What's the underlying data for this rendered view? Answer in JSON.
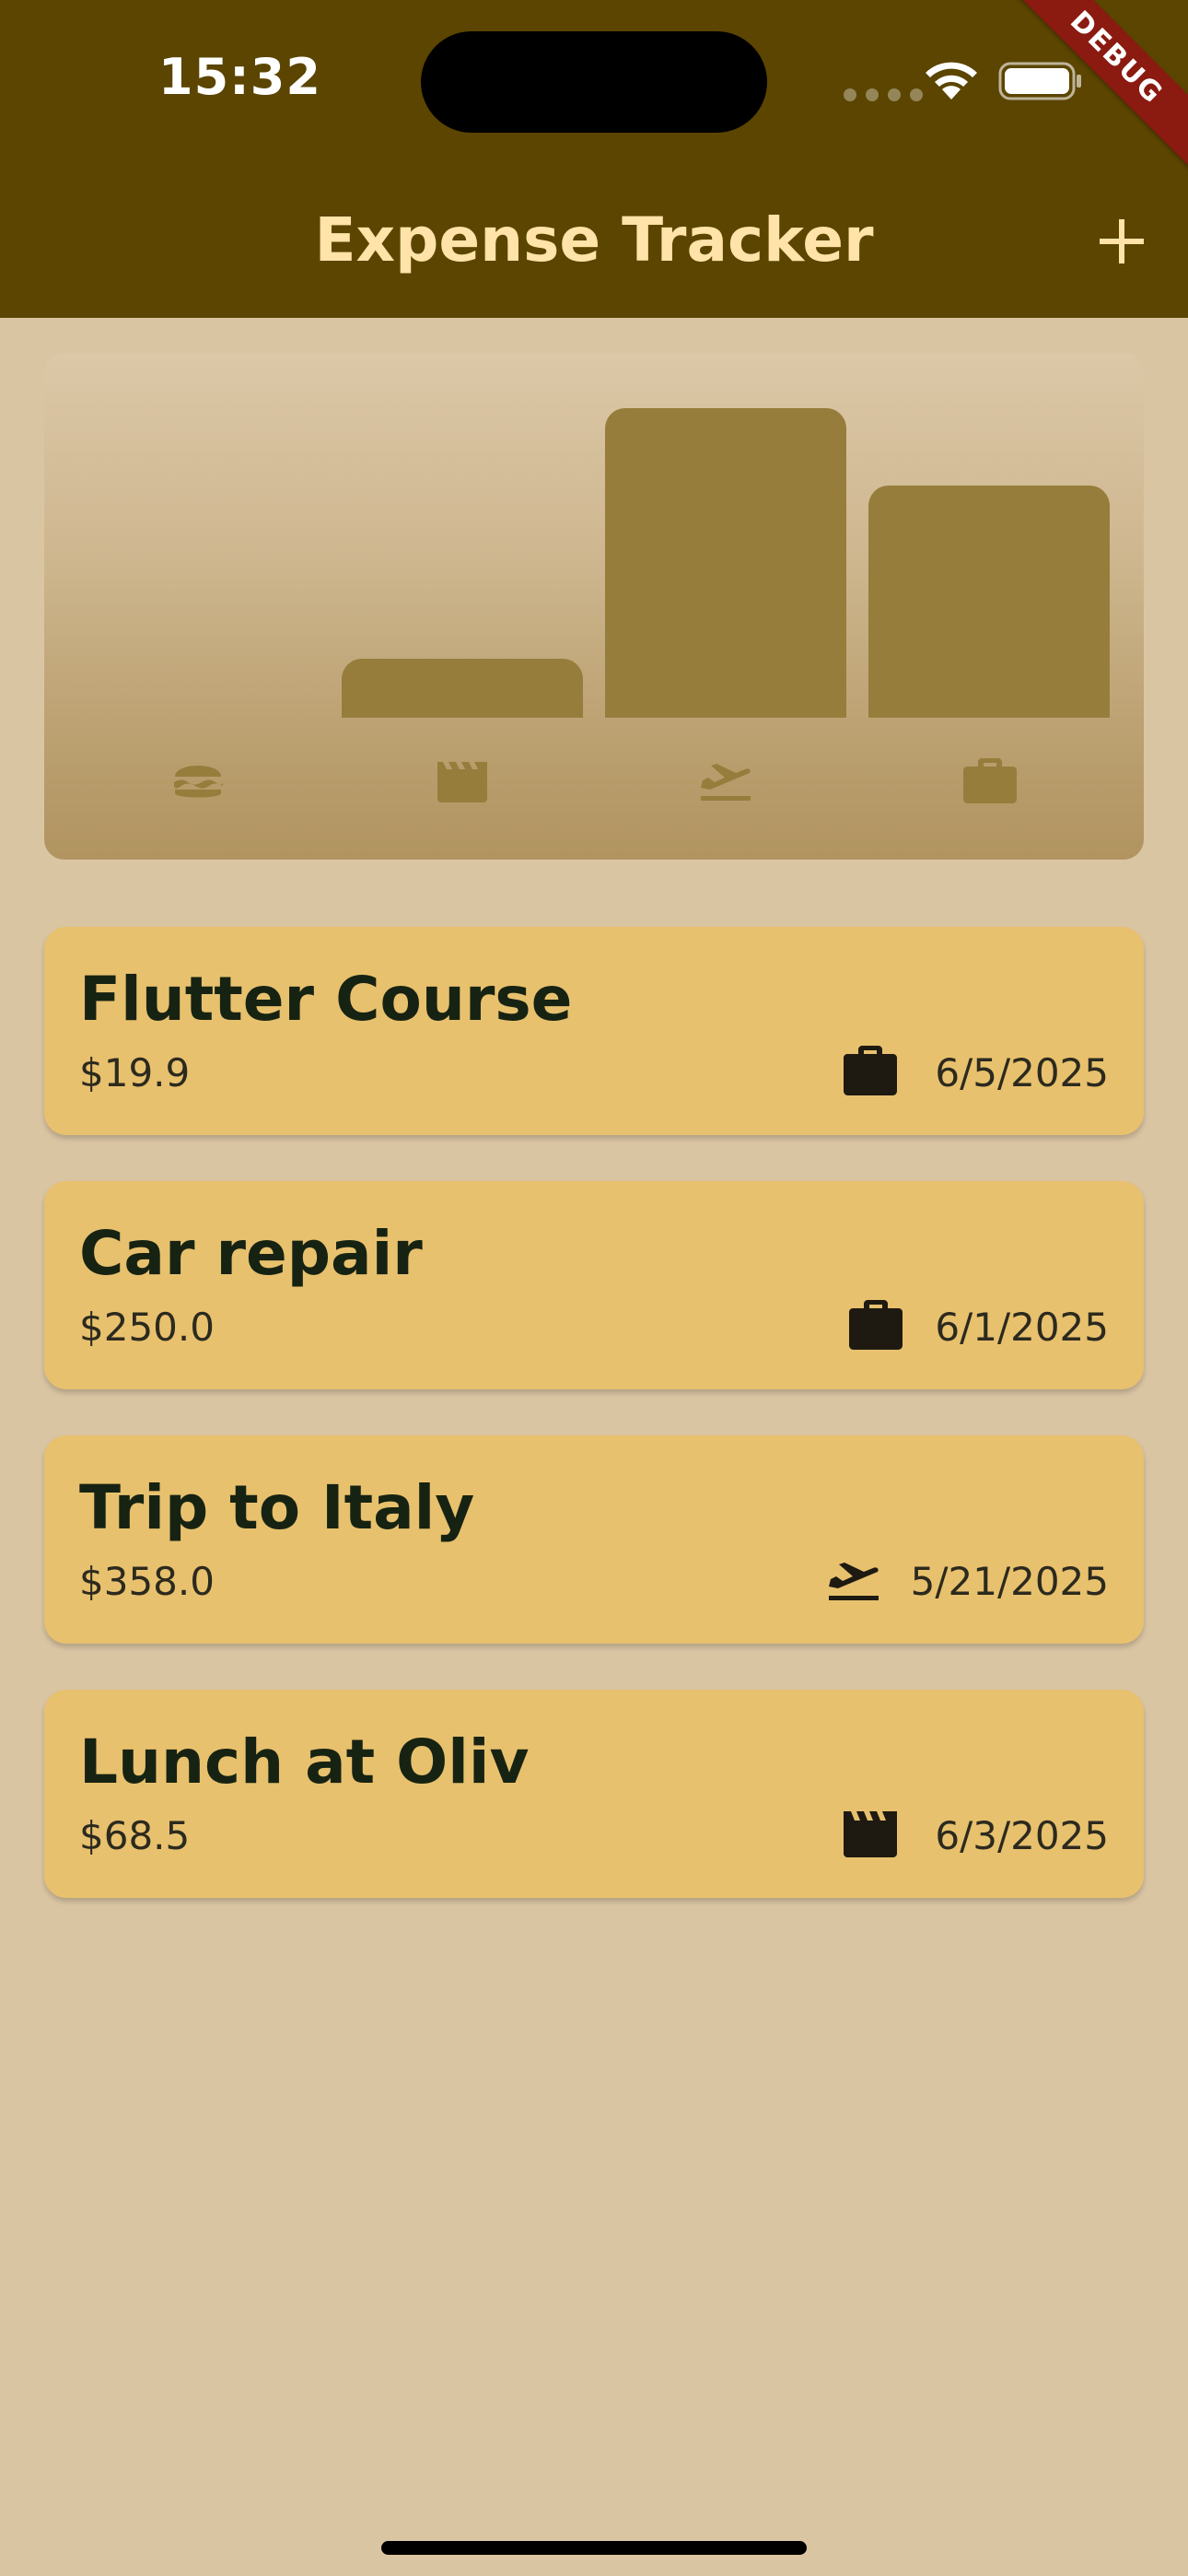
{
  "status_bar": {
    "time": "15:32"
  },
  "debug_banner": "DEBUG",
  "app_bar": {
    "title": "Expense Tracker",
    "add_icon": "plus-icon"
  },
  "chart": {
    "categories": [
      "food",
      "leisure",
      "travel",
      "work"
    ],
    "category_icons": [
      "burger-icon",
      "movie-clapper-icon",
      "flight-takeoff-icon",
      "briefcase-icon"
    ],
    "relative_fill": [
      0.0,
      0.19,
      1.0,
      0.75
    ],
    "bar_color": "#967D3C"
  },
  "expenses": [
    {
      "title": "Flutter Course",
      "amount": "$19.9",
      "date": "6/5/2025",
      "category_icon": "briefcase-icon"
    },
    {
      "title": "Car repair",
      "amount": "$250.0",
      "date": "6/1/2025",
      "category_icon": "briefcase-icon"
    },
    {
      "title": "Trip to Italy",
      "amount": "$358.0",
      "date": "5/21/2025",
      "category_icon": "flight-takeoff-icon"
    },
    {
      "title": "Lunch at Oliv",
      "amount": "$68.5",
      "date": "6/3/2025",
      "category_icon": "movie-clapper-icon"
    }
  ],
  "colors": {
    "app_bar": "#5B4500",
    "title_text": "#FFE3A8",
    "background": "#DAC5A3",
    "card": "#E8C16E",
    "card_text": "#172312"
  }
}
